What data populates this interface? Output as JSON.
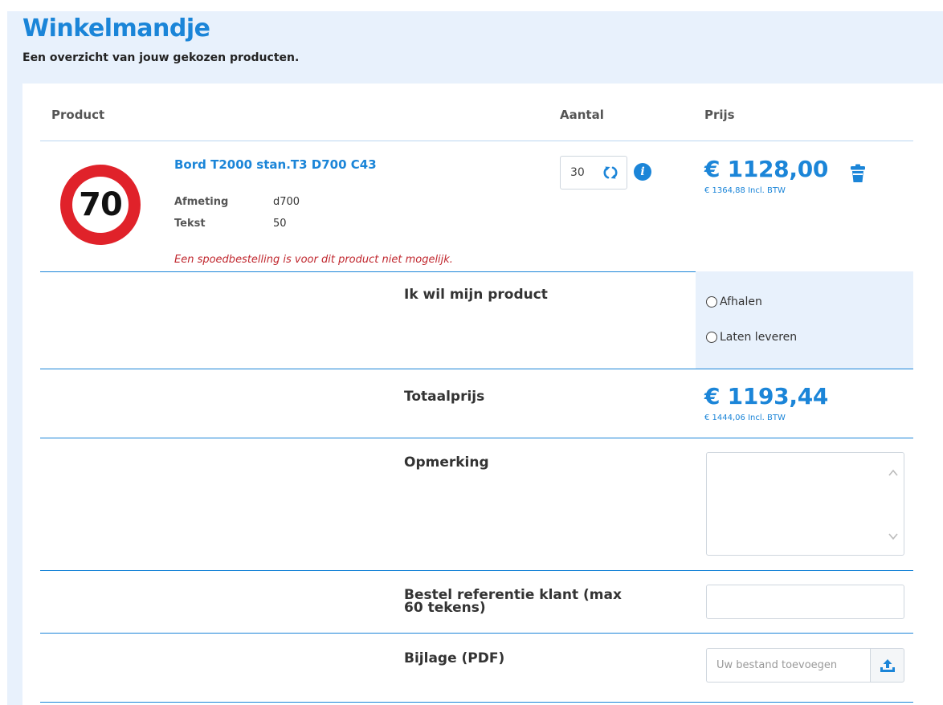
{
  "page": {
    "title": "Winkelmandje",
    "subtitle": "Een overzicht van jouw gekozen producten."
  },
  "table_headers": {
    "product": "Product",
    "quantity": "Aantal",
    "price": "Prijs"
  },
  "product": {
    "name": "Bord T2000 stan.T3 D700 C43",
    "sign_text": "70",
    "attributes": [
      {
        "label": "Afmeting",
        "value": "d700"
      },
      {
        "label": "Tekst",
        "value": "50"
      }
    ],
    "rush_note": "Een spoedbestelling is voor dit product niet mogelijk.",
    "quantity": "30",
    "info_glyph": "i",
    "price": "€ 1128,00",
    "price_incl": "€ 1364,88 Incl. BTW"
  },
  "delivery": {
    "label": "Ik wil mijn product",
    "options": [
      "Afhalen",
      "Laten leveren"
    ]
  },
  "total": {
    "label": "Totaalprijs",
    "price": "€ 1193,44",
    "price_incl": "€ 1444,06 Incl. BTW"
  },
  "remark": {
    "label": "Opmerking",
    "value": ""
  },
  "reference": {
    "label_line1": "Bestel referentie klant (max",
    "label_line2": "60 tekens)",
    "value": ""
  },
  "attachment": {
    "label": "Bijlage (PDF)",
    "placeholder": "Uw bestand toevoegen"
  },
  "colors": {
    "accent": "#1b85d8",
    "panel": "#e8f1fc",
    "warning": "#c0262d",
    "sign_red": "#e0222a"
  },
  "icons": [
    "refresh-icon",
    "info-icon",
    "trash-icon",
    "chevron-up-icon",
    "chevron-down-icon",
    "upload-icon"
  ]
}
